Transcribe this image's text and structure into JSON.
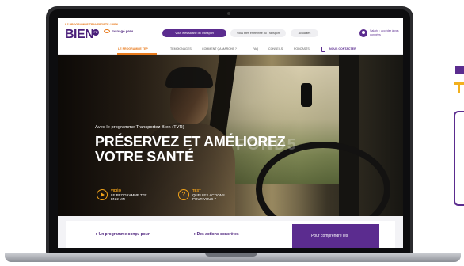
{
  "brand": {
    "logo_small": "LE PROGRAMME TRANSPORTE / BIEN",
    "logo_big": "BIEN",
    "round_badge": "FE",
    "partner": "managé prev"
  },
  "header": {
    "primary_pill": "Vous êtes salarié du Transport",
    "secondary_pill": "Vous êtes entreprise du Transport",
    "news_pill": "Actualités",
    "account": "Salarié : accéder à vos données"
  },
  "nav": {
    "items": [
      "LE PROGRAMME TEP",
      "TÉMOIGNAGES",
      "COMMENT ÇA MARCHE ?",
      "FAQ",
      "CONSEILS",
      "PODCASTS"
    ],
    "contact": "NOUS CONTACTER"
  },
  "hero": {
    "subtitle": "Avec le programme Transportez Bien (TVR)",
    "title_line1": "PRÉSERVEZ ET AMÉLIOREZ",
    "title_line2": "VOTRE SANTÉ",
    "watermark": "FOND5",
    "cta_video": {
      "kicker": "VIDÉO",
      "text": "LE PROGRAMME TTR EN 2 MN"
    },
    "cta_test": {
      "kicker": "TEST",
      "text": "QUELLES ACTIONS POUR VOUS ?"
    }
  },
  "below": {
    "link1": "Un programme conçu pour",
    "link2": "Des actions concrètes",
    "purple": "Pour comprendre les"
  },
  "colors": {
    "brand_purple": "#5b2c8f",
    "accent_orange": "#e87a1c",
    "cta_yellow": "#f0a21a"
  }
}
